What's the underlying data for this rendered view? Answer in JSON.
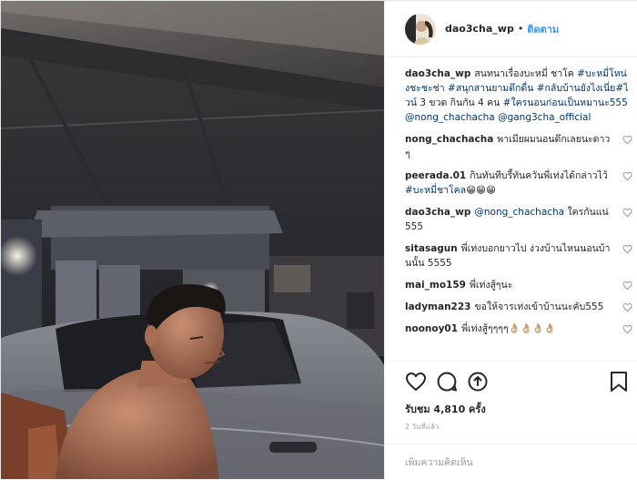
{
  "post": {
    "username": "dao3cha_wp",
    "separator": "•",
    "follow_label": "ติดตาม",
    "caption": {
      "user": "dao3cha_wp",
      "text": "สนทนาเรื่องบะหมี่ ชาโค ",
      "tags_text": "#บะหมี่โหน่งชะชะช่า #สนุกสานยามดึกดื่น #กลับบ้านยังไงเนี่ย#ไวน์",
      "text2": " 3 ขวด กินกัน 4 คน ",
      "tags_text2": "#ใครนอนก่อนเป็นหมานะ555",
      "mentions": "@nong_chachacha @gang3cha_official"
    },
    "comments": [
      {
        "user": "nong_chachacha",
        "text": "พาเมียผมนอนดึกเลยนะดาวๆ"
      },
      {
        "user": "peerada.01",
        "text": "กินทันทีบรี้ทันควันพี่เท่งได้กล่าวไว้",
        "tag": "#บะหมี่ชาโคล",
        "emoji": "😁😁😁"
      },
      {
        "user": "dao3cha_wp",
        "mention": "@nong_chachacha",
        "text": " ใครกันแน่555"
      },
      {
        "user": "sitasagun",
        "text": "พี่เท่งบอกยาวไป ง่วงบ้านไหนนอนบ้านนั้น 5555"
      },
      {
        "user": "mai_mo159",
        "text": "พี่เท่งสู้ๆนะ"
      },
      {
        "user": "ladyman223",
        "text": "ขอให้จารเท่งเข้าบ้านนะคับ555"
      },
      {
        "user": "noonoy01",
        "text": "พี่เท่งสู้ๆๆๆๆ",
        "emoji": "👌🏼👌🏼👌🏼👌🏼"
      }
    ],
    "likes_text": "รับชม 4,810 ครั้ง",
    "time_text": "2 วันที่แล้ว",
    "add_comment_placeholder": "เพิ่มความคิดเห็น",
    "icons": [
      "heart-icon",
      "comment-icon",
      "share-icon",
      "bookmark-icon"
    ],
    "colors": {
      "link": "#003569",
      "follow": "#3897f0",
      "text": "#262626",
      "muted": "#999999"
    }
  }
}
